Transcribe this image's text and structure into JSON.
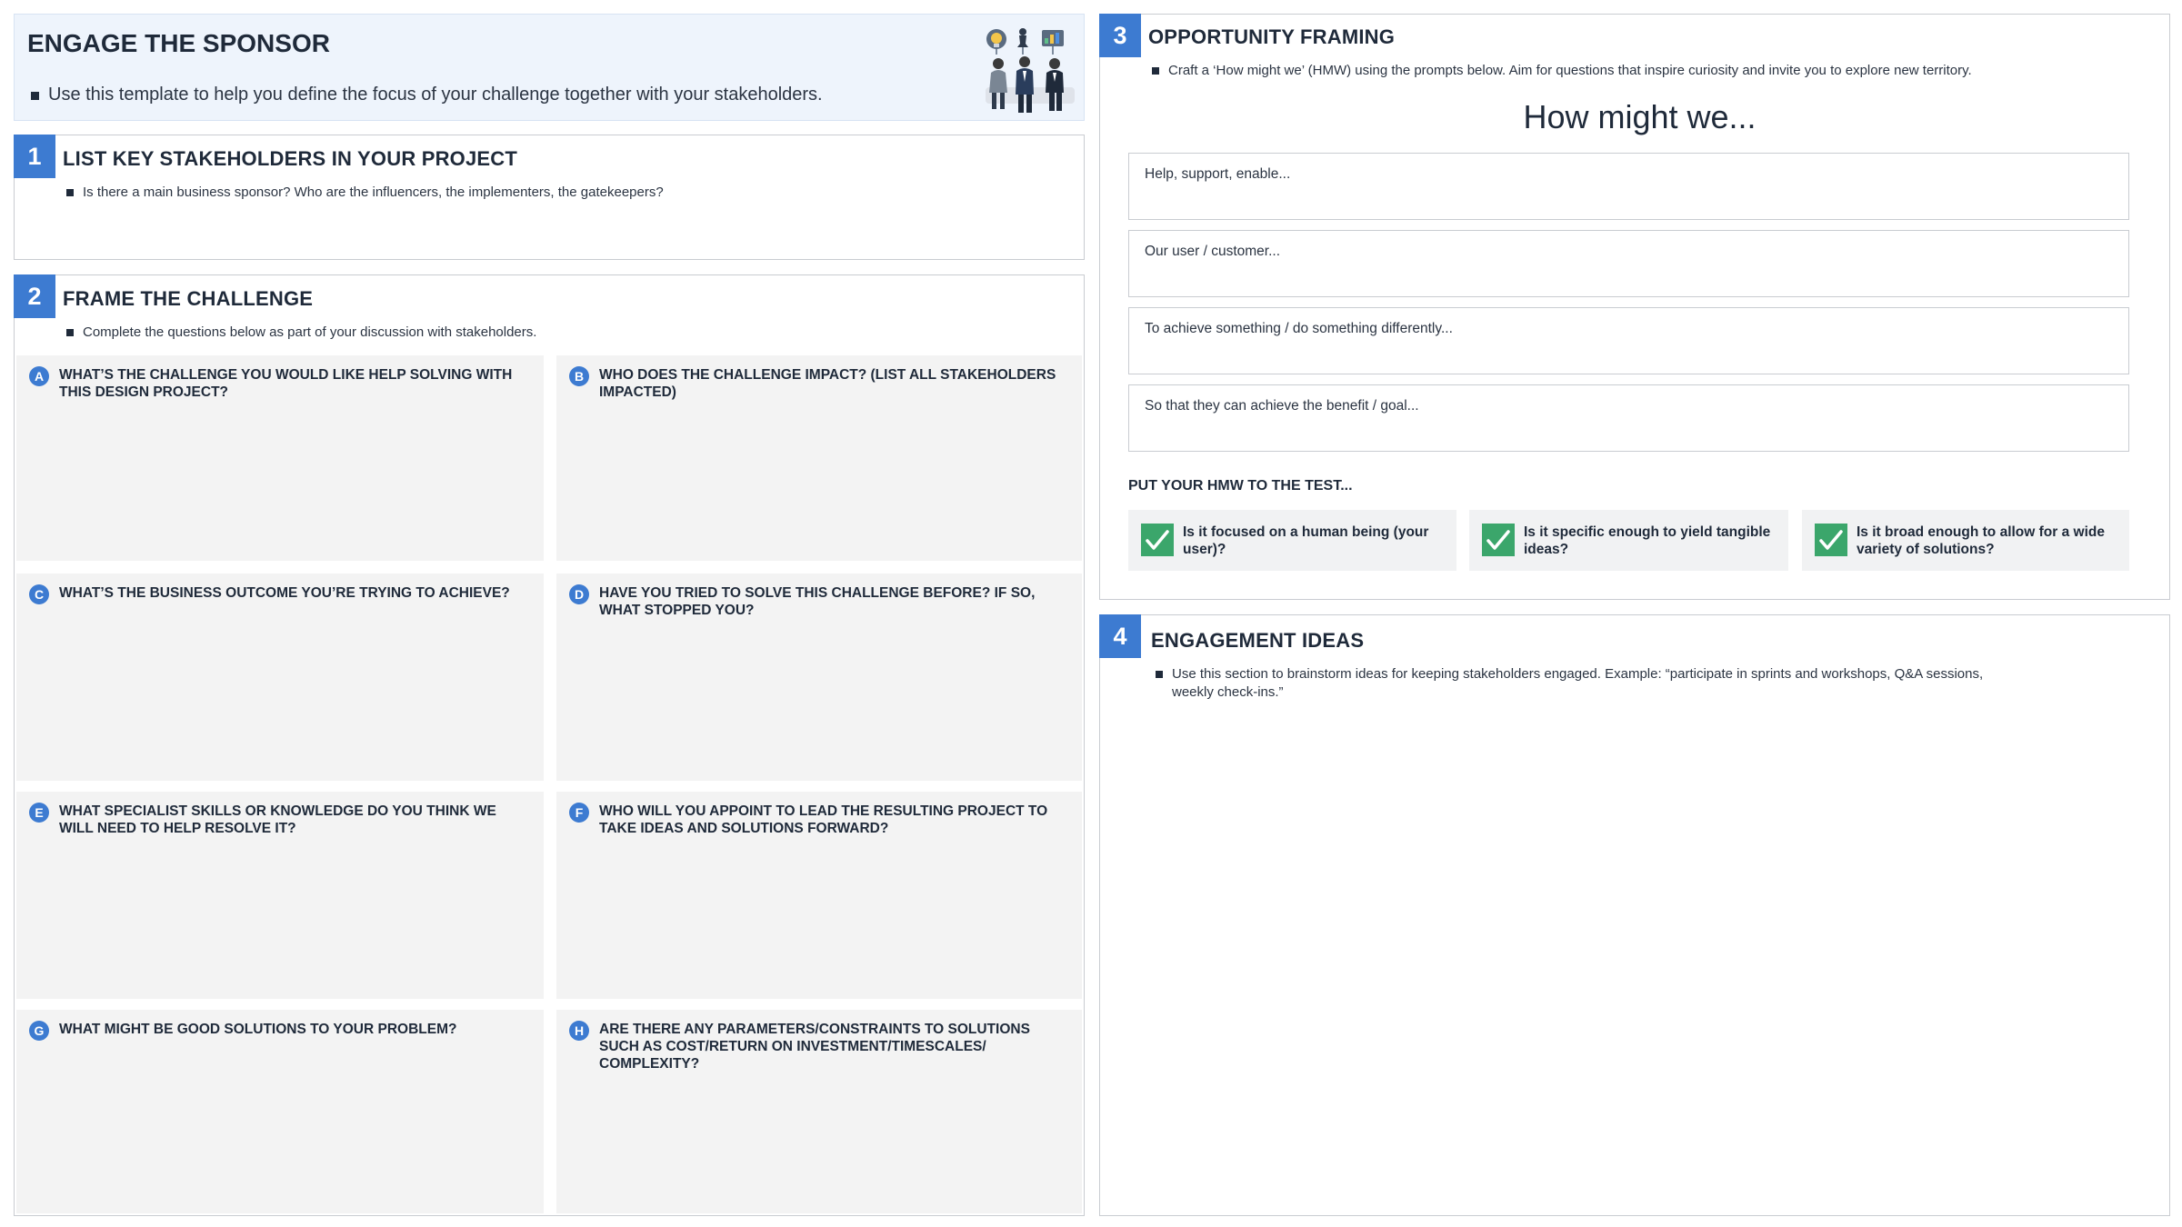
{
  "header": {
    "title": "ENGAGE THE SPONSOR",
    "subtitle": "Use this template to help you define the focus of your challenge together with your stakeholders."
  },
  "section1": {
    "number": "1",
    "title": "LIST KEY STAKEHOLDERS IN YOUR PROJECT",
    "bullet": "Is there a main business sponsor? Who are the influencers, the implementers, the gatekeepers?"
  },
  "section2": {
    "number": "2",
    "title": "FRAME THE CHALLENGE",
    "bullet": "Complete the questions below as part of your discussion with stakeholders.",
    "questions": [
      {
        "letter": "A",
        "text": "What’s the challenge you would like help solving with this design project?"
      },
      {
        "letter": "B",
        "text": "Who does the challenge impact? (List all stakeholders impacted)"
      },
      {
        "letter": "C",
        "text": "What’s the business outcome you’re trying to achieve?"
      },
      {
        "letter": "D",
        "text": "Have you tried to solve this challenge before? If so, what stopped you?"
      },
      {
        "letter": "E",
        "text": "What specialist skills or knowledge do you think we will need to help resolve it?"
      },
      {
        "letter": "F",
        "text": "Who will you appoint to lead the resulting project to take ideas and solutions forward?"
      },
      {
        "letter": "G",
        "text": "What might be good solutions to your problem?"
      },
      {
        "letter": "H",
        "text": "Are there any parameters/constraints to solutions such as cost/return on investment/timescales/ complexity?"
      }
    ]
  },
  "section3": {
    "number": "3",
    "title": "OPPORTUNITY FRAMING",
    "bullet": "Craft a ‘How might we’ (HMW) using the prompts below. Aim for questions that inspire curiosity and invite you to explore new territory.",
    "heading": "How might we...",
    "prompts": [
      "Help, support, enable...",
      "Our user / customer...",
      "To achieve something / do something differently...",
      "So that they can achieve the benefit / goal..."
    ],
    "test_label": "PUT YOUR HMW TO THE TEST...",
    "tests": [
      "Is it focused on a human being (your user)?",
      "Is it specific enough to yield tangible ideas?",
      "Is it broad enough to allow for a wide variety of solutions?"
    ]
  },
  "section4": {
    "number": "4",
    "title": "ENGAGEMENT IDEAS",
    "bullet": "Use this section to brainstorm ideas for keeping stakeholders engaged. Example: “participate in sprints and workshops, Q&A sessions, weekly check-ins.”"
  },
  "colors": {
    "accent": "#3d7bd1",
    "header_bg": "#eef4fc",
    "cell_bg": "#f3f3f3",
    "check": "#3ba66b"
  },
  "icons": [
    "lightbulb-icon",
    "chess-piece-icon",
    "chart-icon",
    "check-icon"
  ]
}
